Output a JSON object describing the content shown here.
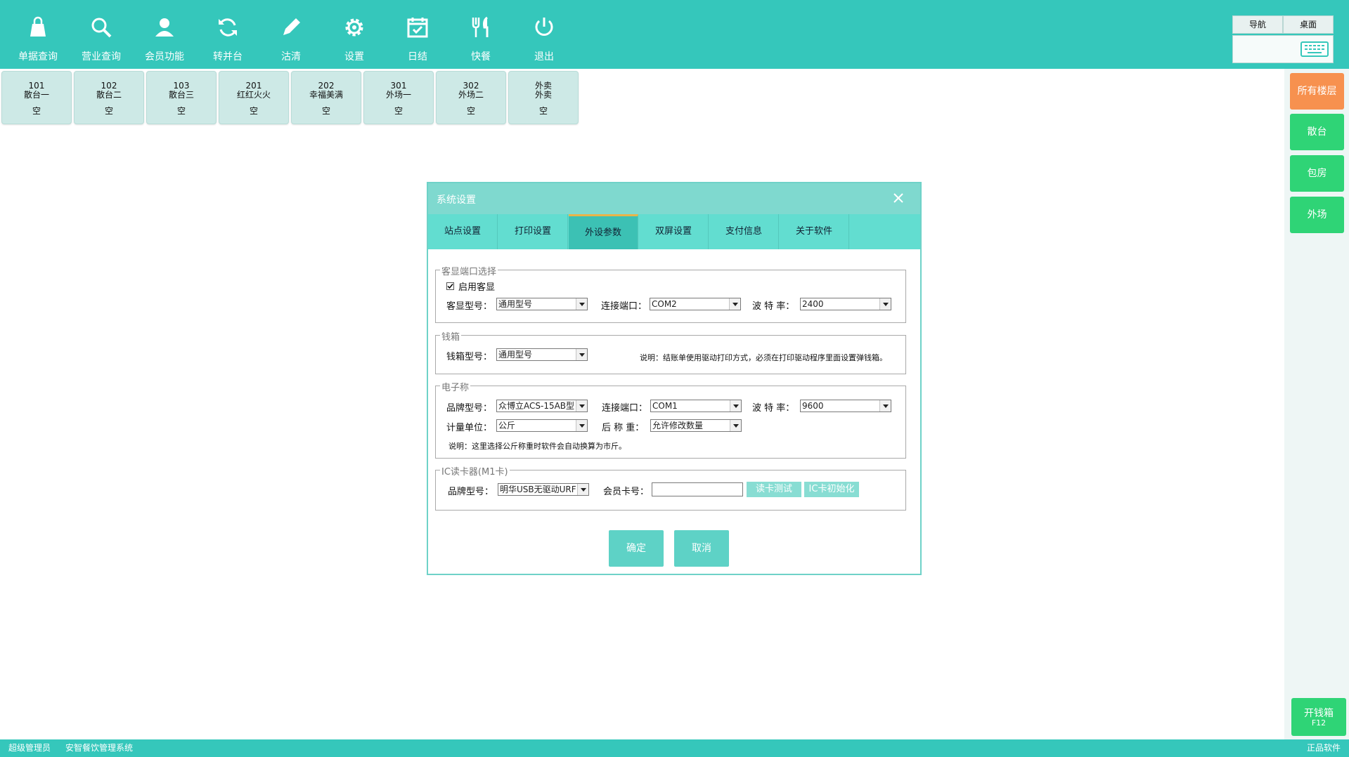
{
  "toolbar": {
    "items": [
      {
        "label": "单据查询",
        "icon": "bag-icon"
      },
      {
        "label": "营业查询",
        "icon": "search-icon"
      },
      {
        "label": "会员功能",
        "icon": "user-icon"
      },
      {
        "label": "转并台",
        "icon": "refresh-icon"
      },
      {
        "label": "沽清",
        "icon": "pencil-icon"
      },
      {
        "label": "设置",
        "icon": "gear-icon"
      },
      {
        "label": "日结",
        "icon": "calendar-check-icon"
      },
      {
        "label": "快餐",
        "icon": "fork-knife-icon"
      },
      {
        "label": "退出",
        "icon": "power-icon"
      }
    ],
    "nav_label": "导航",
    "desktop_label": "桌面"
  },
  "tables": [
    {
      "no": "101",
      "name": "散台一",
      "status": "空"
    },
    {
      "no": "102",
      "name": "散台二",
      "status": "空"
    },
    {
      "no": "103",
      "name": "散台三",
      "status": "空"
    },
    {
      "no": "201",
      "name": "红红火火",
      "status": "空"
    },
    {
      "no": "202",
      "name": "幸福美满",
      "status": "空"
    },
    {
      "no": "301",
      "name": "外场一",
      "status": "空"
    },
    {
      "no": "302",
      "name": "外场二",
      "status": "空"
    },
    {
      "no": "外卖",
      "name": "外卖",
      "status": "空"
    }
  ],
  "sidebar": {
    "floors": [
      {
        "label": "所有楼层",
        "color": "#f7914f"
      },
      {
        "label": "散台",
        "color": "#2fd476"
      },
      {
        "label": "包房",
        "color": "#2fd476"
      },
      {
        "label": "外场",
        "color": "#2fd476"
      }
    ],
    "cash_drawer_label": "开钱箱",
    "cash_drawer_key": "F12"
  },
  "status_bar": {
    "user": "超级管理员",
    "system": "安智餐饮管理系统",
    "right": "正品软件"
  },
  "dialog": {
    "title": "系统设置",
    "tabs": [
      "站点设置",
      "打印设置",
      "外设参数",
      "双屏设置",
      "支付信息",
      "关于软件"
    ],
    "active_tab": "外设参数",
    "customer_display": {
      "legend": "客显端口选择",
      "enable_label": "启用客显",
      "enabled": true,
      "model_label": "客显型号：",
      "model_value": "通用型号",
      "port_label": "连接端口：",
      "port_value": "COM2",
      "baud_label": "波 特 率：",
      "baud_value": "2400"
    },
    "cash_box": {
      "legend": "钱箱",
      "model_label": "钱箱型号：",
      "model_value": "通用型号",
      "note": "说明：结账单使用驱动打印方式，必须在打印驱动程序里面设置弹钱箱。"
    },
    "scale": {
      "legend": "电子称",
      "brand_label": "品牌型号：",
      "brand_value": "众博立ACS-15AB型",
      "port_label": "连接端口：",
      "port_value": "COM1",
      "baud_label": "波 特 率：",
      "baud_value": "9600",
      "unit_label": "计量单位：",
      "unit_value": "公斤",
      "after_label": "后 称 重：",
      "after_value": "允许修改数量",
      "note": "说明：这里选择公斤称重时软件会自动换算为市斤。"
    },
    "ic_reader": {
      "legend": "IC读卡器(M1卡)",
      "brand_label": "品牌型号：",
      "brand_value": "明华USB无驱动URF",
      "card_label": "会员卡号：",
      "card_value": "",
      "read_test": "读卡测试",
      "init": "IC卡初始化"
    },
    "ok": "确定",
    "cancel": "取消"
  }
}
